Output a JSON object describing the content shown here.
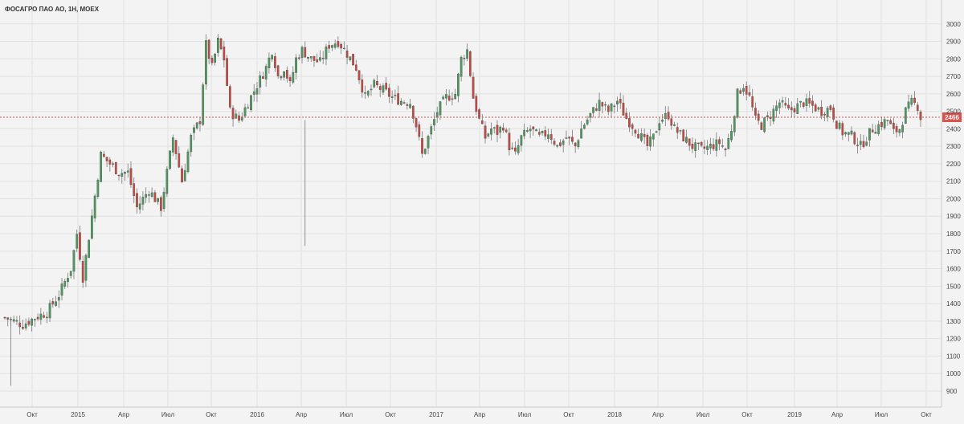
{
  "chart_data": {
    "type": "candlestick",
    "title": "ФОСАГРО ПАО АО, 1Н, МОЕХ",
    "current_price": 2466,
    "ylim": [
      840,
      3100
    ],
    "y_ticks": [
      900,
      1000,
      1100,
      1200,
      1300,
      1400,
      1500,
      1600,
      1700,
      1800,
      1900,
      2000,
      2100,
      2200,
      2300,
      2400,
      2500,
      2600,
      2700,
      2800,
      2900,
      3000
    ],
    "x_ticks": [
      "Окт",
      "2015",
      "Апр",
      "Июл",
      "Окт",
      "2016",
      "Апр",
      "Июл",
      "Окт",
      "2017",
      "Апр",
      "Июл",
      "Окт",
      "2018",
      "Апр",
      "Июл",
      "Окт",
      "2019",
      "Апр",
      "Июл",
      "Окт"
    ],
    "grid": true,
    "colors": {
      "up": "#4a9a5e",
      "down": "#c9473f",
      "grid": "#e2e2e2",
      "price_line": "#d9534f",
      "background": "#f3f3f3"
    },
    "anchors": [
      [
        0,
        1320
      ],
      [
        6,
        1280
      ],
      [
        10,
        1320
      ],
      [
        14,
        1350
      ],
      [
        18,
        1450
      ],
      [
        22,
        1600
      ],
      [
        24,
        1800
      ],
      [
        26,
        1550
      ],
      [
        29,
        1900
      ],
      [
        32,
        2250
      ],
      [
        35,
        2200
      ],
      [
        38,
        2150
      ],
      [
        41,
        2150
      ],
      [
        44,
        1950
      ],
      [
        48,
        2050
      ],
      [
        52,
        1950
      ],
      [
        56,
        2350
      ],
      [
        59,
        2100
      ],
      [
        62,
        2350
      ],
      [
        65,
        2450
      ],
      [
        67,
        2880
      ],
      [
        69,
        2750
      ],
      [
        71,
        2900
      ],
      [
        73,
        2800
      ],
      [
        75,
        2500
      ],
      [
        78,
        2450
      ],
      [
        81,
        2550
      ],
      [
        84,
        2650
      ],
      [
        87,
        2750
      ],
      [
        89,
        2850
      ],
      [
        91,
        2700
      ],
      [
        93,
        2750
      ],
      [
        95,
        2650
      ],
      [
        97,
        2800
      ],
      [
        99,
        2850
      ],
      [
        102,
        2800
      ],
      [
        105,
        2780
      ],
      [
        108,
        2880
      ],
      [
        111,
        2900
      ],
      [
        114,
        2830
      ],
      [
        117,
        2750
      ],
      [
        120,
        2580
      ],
      [
        123,
        2650
      ],
      [
        126,
        2620
      ],
      [
        129,
        2580
      ],
      [
        132,
        2560
      ],
      [
        135,
        2550
      ],
      [
        137,
        2420
      ],
      [
        139,
        2250
      ],
      [
        141,
        2350
      ],
      [
        144,
        2500
      ],
      [
        147,
        2580
      ],
      [
        150,
        2600
      ],
      [
        152,
        2800
      ],
      [
        154,
        2850
      ],
      [
        156,
        2580
      ],
      [
        158,
        2450
      ],
      [
        160,
        2350
      ],
      [
        162,
        2400
      ],
      [
        164,
        2380
      ],
      [
        166,
        2420
      ],
      [
        168,
        2300
      ],
      [
        170,
        2250
      ],
      [
        172,
        2350
      ],
      [
        175,
        2400
      ],
      [
        178,
        2350
      ],
      [
        181,
        2380
      ],
      [
        184,
        2300
      ],
      [
        187,
        2350
      ],
      [
        190,
        2300
      ],
      [
        192,
        2400
      ],
      [
        195,
        2480
      ],
      [
        198,
        2550
      ],
      [
        201,
        2500
      ],
      [
        204,
        2560
      ],
      [
        207,
        2460
      ],
      [
        210,
        2400
      ],
      [
        212,
        2350
      ],
      [
        214,
        2300
      ],
      [
        216,
        2350
      ],
      [
        218,
        2450
      ],
      [
        221,
        2480
      ],
      [
        223,
        2400
      ],
      [
        226,
        2350
      ],
      [
        229,
        2300
      ],
      [
        232,
        2280
      ],
      [
        235,
        2300
      ],
      [
        238,
        2320
      ],
      [
        240,
        2280
      ],
      [
        242,
        2400
      ],
      [
        244,
        2600
      ],
      [
        246,
        2650
      ],
      [
        248,
        2580
      ],
      [
        250,
        2450
      ],
      [
        252,
        2420
      ],
      [
        255,
        2480
      ],
      [
        258,
        2550
      ],
      [
        261,
        2500
      ],
      [
        263,
        2520
      ],
      [
        266,
        2550
      ],
      [
        269,
        2530
      ],
      [
        272,
        2500
      ],
      [
        275,
        2520
      ],
      [
        277,
        2430
      ],
      [
        279,
        2380
      ],
      [
        282,
        2360
      ],
      [
        285,
        2300
      ],
      [
        287,
        2350
      ],
      [
        289,
        2400
      ],
      [
        291,
        2420
      ],
      [
        294,
        2450
      ],
      [
        296,
        2380
      ],
      [
        298,
        2400
      ],
      [
        300,
        2500
      ],
      [
        302,
        2550
      ],
      [
        304,
        2530
      ],
      [
        305,
        2466
      ]
    ]
  }
}
